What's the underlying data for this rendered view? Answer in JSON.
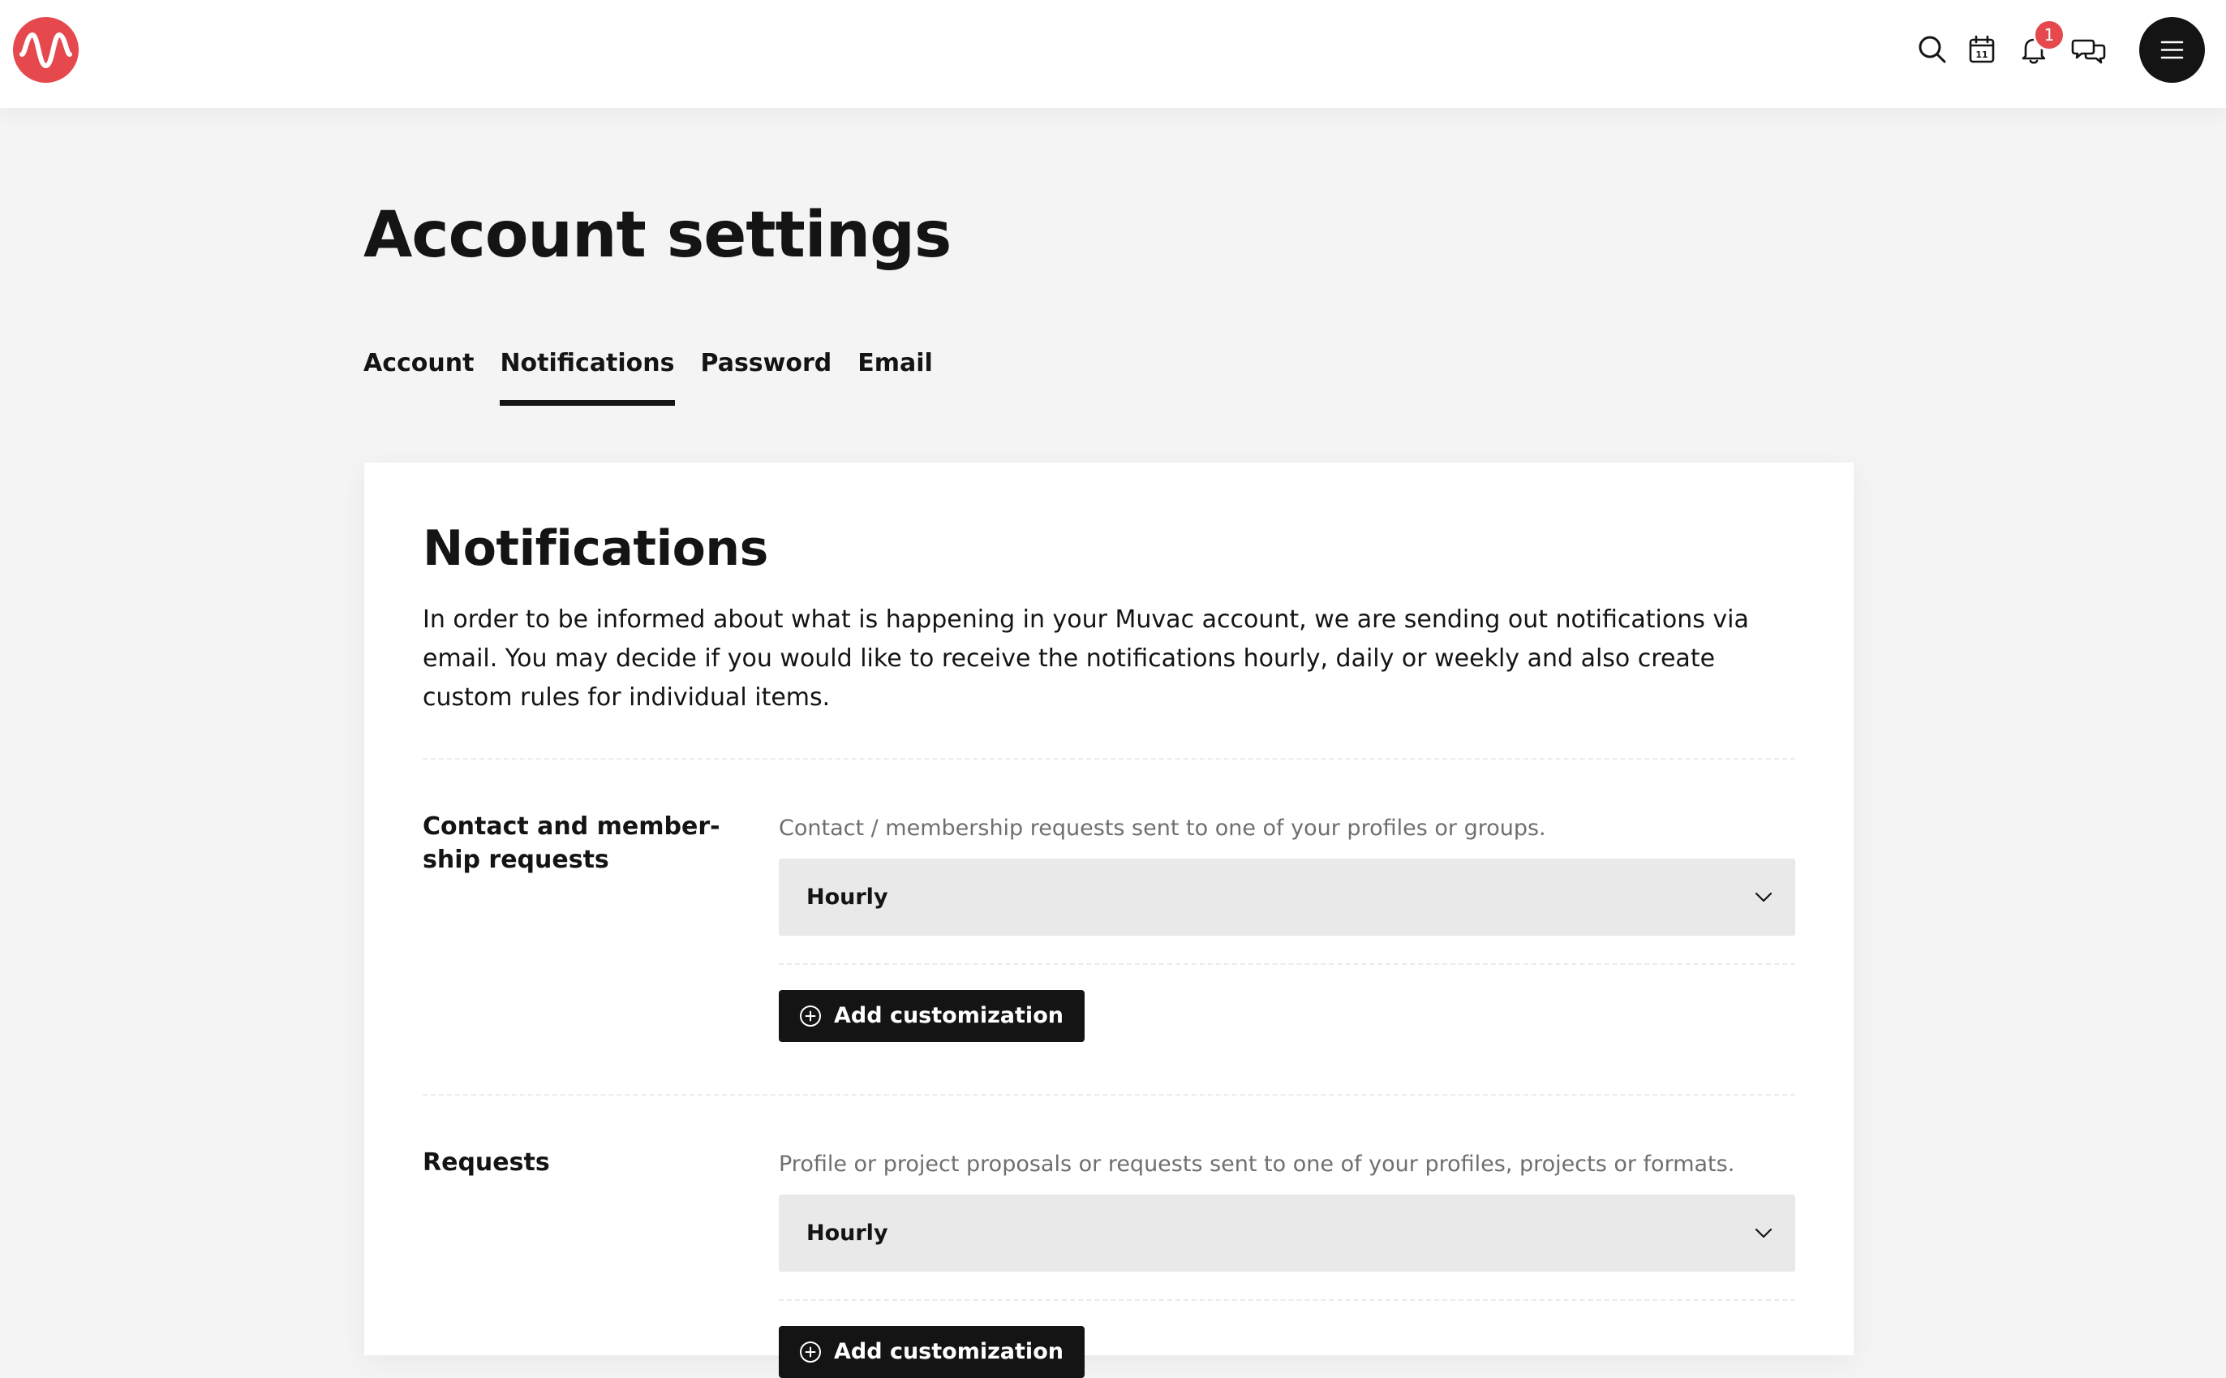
{
  "colors": {
    "brand": "#e5484d",
    "text": "#141414",
    "muted": "#6f6f6f",
    "select_bg": "#e9e9e9",
    "page_bg": "#f4f4f4"
  },
  "header": {
    "logo_icon": "muvac-wave-logo",
    "icons": [
      "search-icon",
      "calendar-icon",
      "bell-icon",
      "chat-icon",
      "menu-icon"
    ],
    "calendar_day": "11",
    "notification_count": "1"
  },
  "page": {
    "title": "Account settings",
    "tabs": [
      {
        "label": "Account",
        "active": false
      },
      {
        "label": "Notifications",
        "active": true
      },
      {
        "label": "Password",
        "active": false
      },
      {
        "label": "Email",
        "active": false
      }
    ]
  },
  "notifications": {
    "title": "Notifications",
    "intro": "In order to be informed about what is happening in your Muvac account, we are sending out notifications via email. You may decide if you would like to receive the notifications hourly, daily or weekly and also create custom rules for individual items.",
    "sections": [
      {
        "label": "Contact and member-ship requests",
        "description": "Contact / membership requests sent to one of your profiles or groups.",
        "frequency": "Hourly",
        "add_button": "Add customization"
      },
      {
        "label": "Requests",
        "description": "Profile or project proposals or requests sent to one of your profiles, projects or formats.",
        "frequency": "Hourly",
        "add_button": "Add customization"
      }
    ]
  }
}
